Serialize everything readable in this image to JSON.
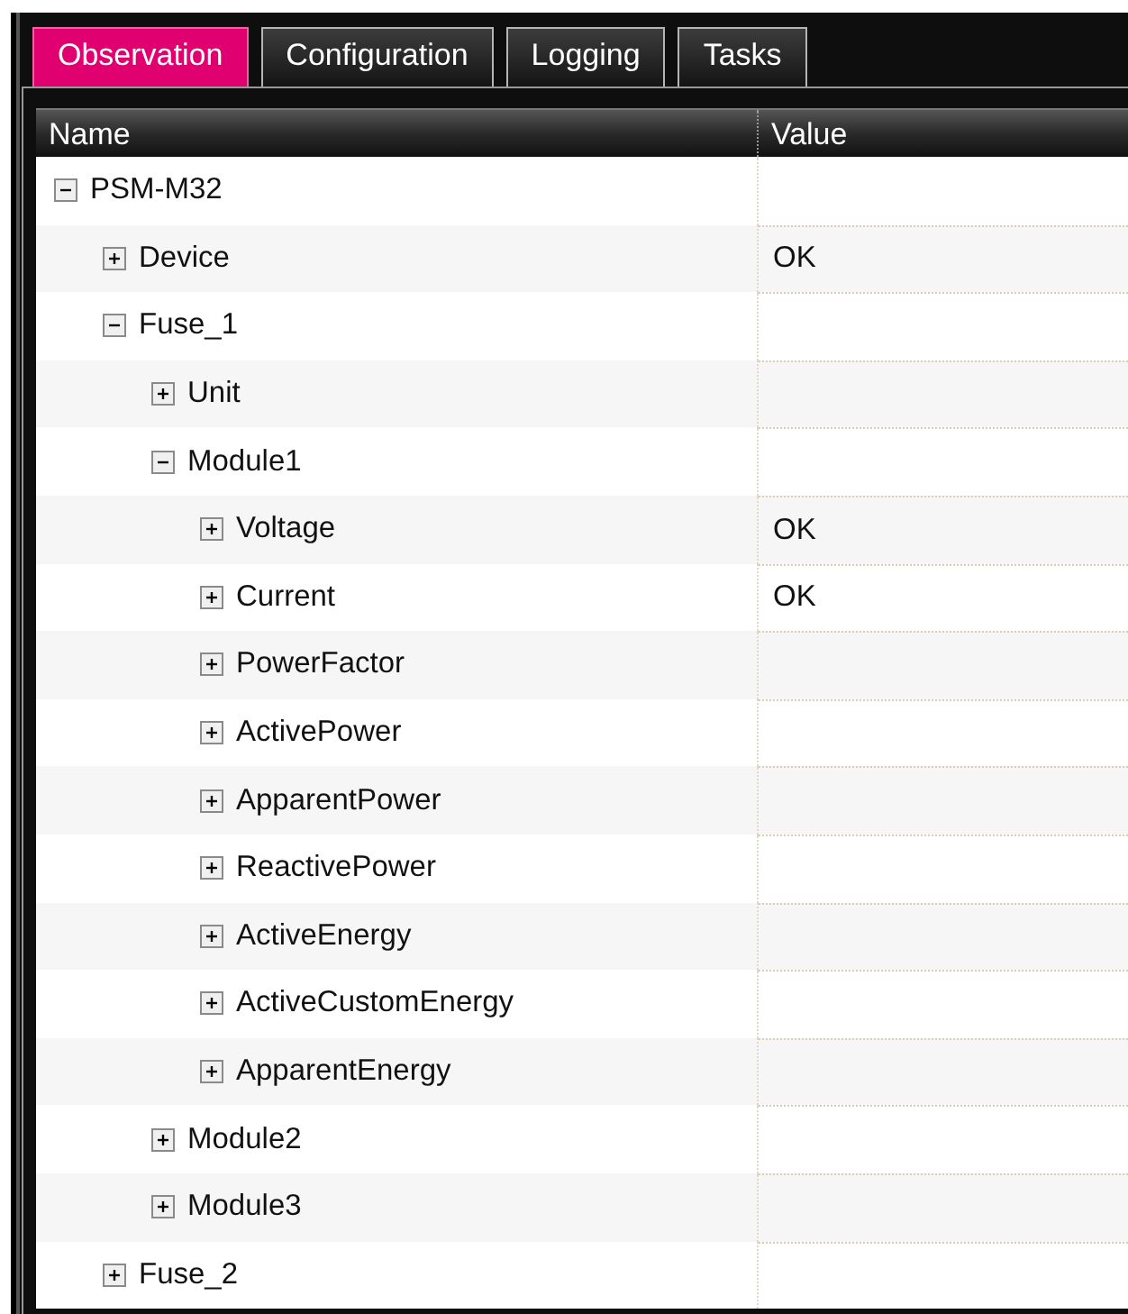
{
  "tabs": [
    {
      "label": "Observation",
      "selected": true
    },
    {
      "label": "Configuration",
      "selected": false
    },
    {
      "label": "Logging",
      "selected": false
    },
    {
      "label": "Tasks",
      "selected": false
    }
  ],
  "table": {
    "columns": [
      "Name",
      "Value"
    ],
    "tree": [
      {
        "name": "PSM-M32",
        "expanded": true,
        "children": [
          {
            "name": "Device",
            "expanded": false,
            "value": "OK"
          },
          {
            "name": "Fuse_1",
            "expanded": true,
            "children": [
              {
                "name": "Unit",
                "expanded": false
              },
              {
                "name": "Module1",
                "expanded": true,
                "children": [
                  {
                    "name": "Voltage",
                    "expanded": false,
                    "value": "OK"
                  },
                  {
                    "name": "Current",
                    "expanded": false,
                    "value": "OK"
                  },
                  {
                    "name": "PowerFactor",
                    "expanded": false
                  },
                  {
                    "name": "ActivePower",
                    "expanded": false
                  },
                  {
                    "name": "ApparentPower",
                    "expanded": false
                  },
                  {
                    "name": "ReactivePower",
                    "expanded": false
                  },
                  {
                    "name": "ActiveEnergy",
                    "expanded": false
                  },
                  {
                    "name": "ActiveCustomEnergy",
                    "expanded": false
                  },
                  {
                    "name": "ApparentEnergy",
                    "expanded": false
                  }
                ]
              },
              {
                "name": "Module2",
                "expanded": false
              },
              {
                "name": "Module3",
                "expanded": false
              }
            ]
          },
          {
            "name": "Fuse_2",
            "expanded": false
          }
        ]
      }
    ]
  }
}
